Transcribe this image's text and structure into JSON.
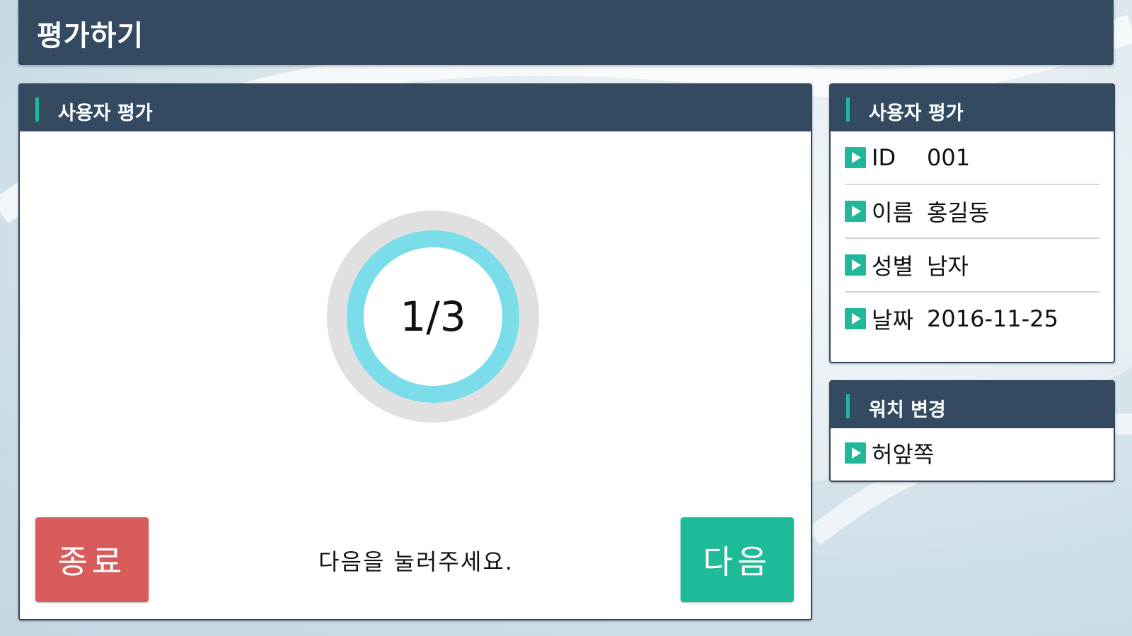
{
  "app": {
    "title": "평가하기"
  },
  "main_panel": {
    "header": "사용자 평가",
    "progress": {
      "text": "1/3",
      "current": 1,
      "total": 3
    },
    "hint": "다음을 눌러주세요.",
    "end_button": "종료",
    "next_button": "다음"
  },
  "user_panel": {
    "header": "사용자 평가",
    "rows": [
      {
        "key": "ID",
        "value": "001"
      },
      {
        "key": "이름",
        "value": "홍길동"
      },
      {
        "key": "성별",
        "value": "남자"
      },
      {
        "key": "날짜",
        "value": "2016-11-25"
      }
    ]
  },
  "position_panel": {
    "header": "워치 변경",
    "value": "허앞쪽"
  },
  "colors": {
    "header_bg": "#344a61",
    "accent": "#1fb89a",
    "ring_outer": "#e0e0e0",
    "ring_inner": "#7adde9",
    "end_button": "#d85c5c",
    "next_button": "#1ebb98"
  },
  "icons": {
    "row_bullet": "play-icon"
  }
}
